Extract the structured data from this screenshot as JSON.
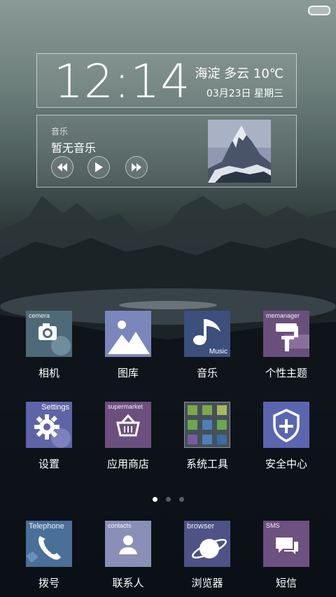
{
  "status": {
    "battery": "battery-icon"
  },
  "clock_widget": {
    "time": "12:14",
    "weather": "海淀  多云  10℃",
    "date": "03月23日  星期三"
  },
  "music_widget": {
    "label": "音乐",
    "title": "暂无音乐",
    "controls": [
      "previous-icon",
      "play-icon",
      "next-icon"
    ]
  },
  "apps": [
    {
      "label": "相机",
      "icon": "camera-icon",
      "caption": "cemera",
      "color": "#4e6a79"
    },
    {
      "label": "图库",
      "icon": "gallery-icon",
      "caption": "",
      "color": "#7b86bd"
    },
    {
      "label": "音乐",
      "icon": "music-icon",
      "caption": "Music",
      "color": "#3c4f7d"
    },
    {
      "label": "个性主题",
      "icon": "theme-icon",
      "caption": "memanager",
      "color": "#6a4f7d"
    },
    {
      "label": "设置",
      "icon": "settings-icon",
      "caption": "Settings",
      "color": "#5f64a8"
    },
    {
      "label": "应用商店",
      "icon": "store-icon",
      "caption": "supermarket",
      "color": "#6d4f7f"
    },
    {
      "label": "系统工具",
      "icon": "tools-folder-icon",
      "caption": "",
      "color": "#45505a"
    },
    {
      "label": "安全中心",
      "icon": "shield-icon",
      "caption": "",
      "color": "#5b66b0"
    }
  ],
  "pager": {
    "pages": 3,
    "active": 1
  },
  "dock": [
    {
      "label": "拨号",
      "icon": "phone-icon",
      "caption": "Telephone",
      "color": "#4a6f98"
    },
    {
      "label": "联系人",
      "icon": "contacts-icon",
      "caption": "contacts",
      "color": "#8a8fb8"
    },
    {
      "label": "浏览器",
      "icon": "browser-icon",
      "caption": "browser",
      "color": "#4e5286"
    },
    {
      "label": "短信",
      "icon": "sms-icon",
      "caption": "SMS",
      "color": "#6c5181"
    }
  ]
}
